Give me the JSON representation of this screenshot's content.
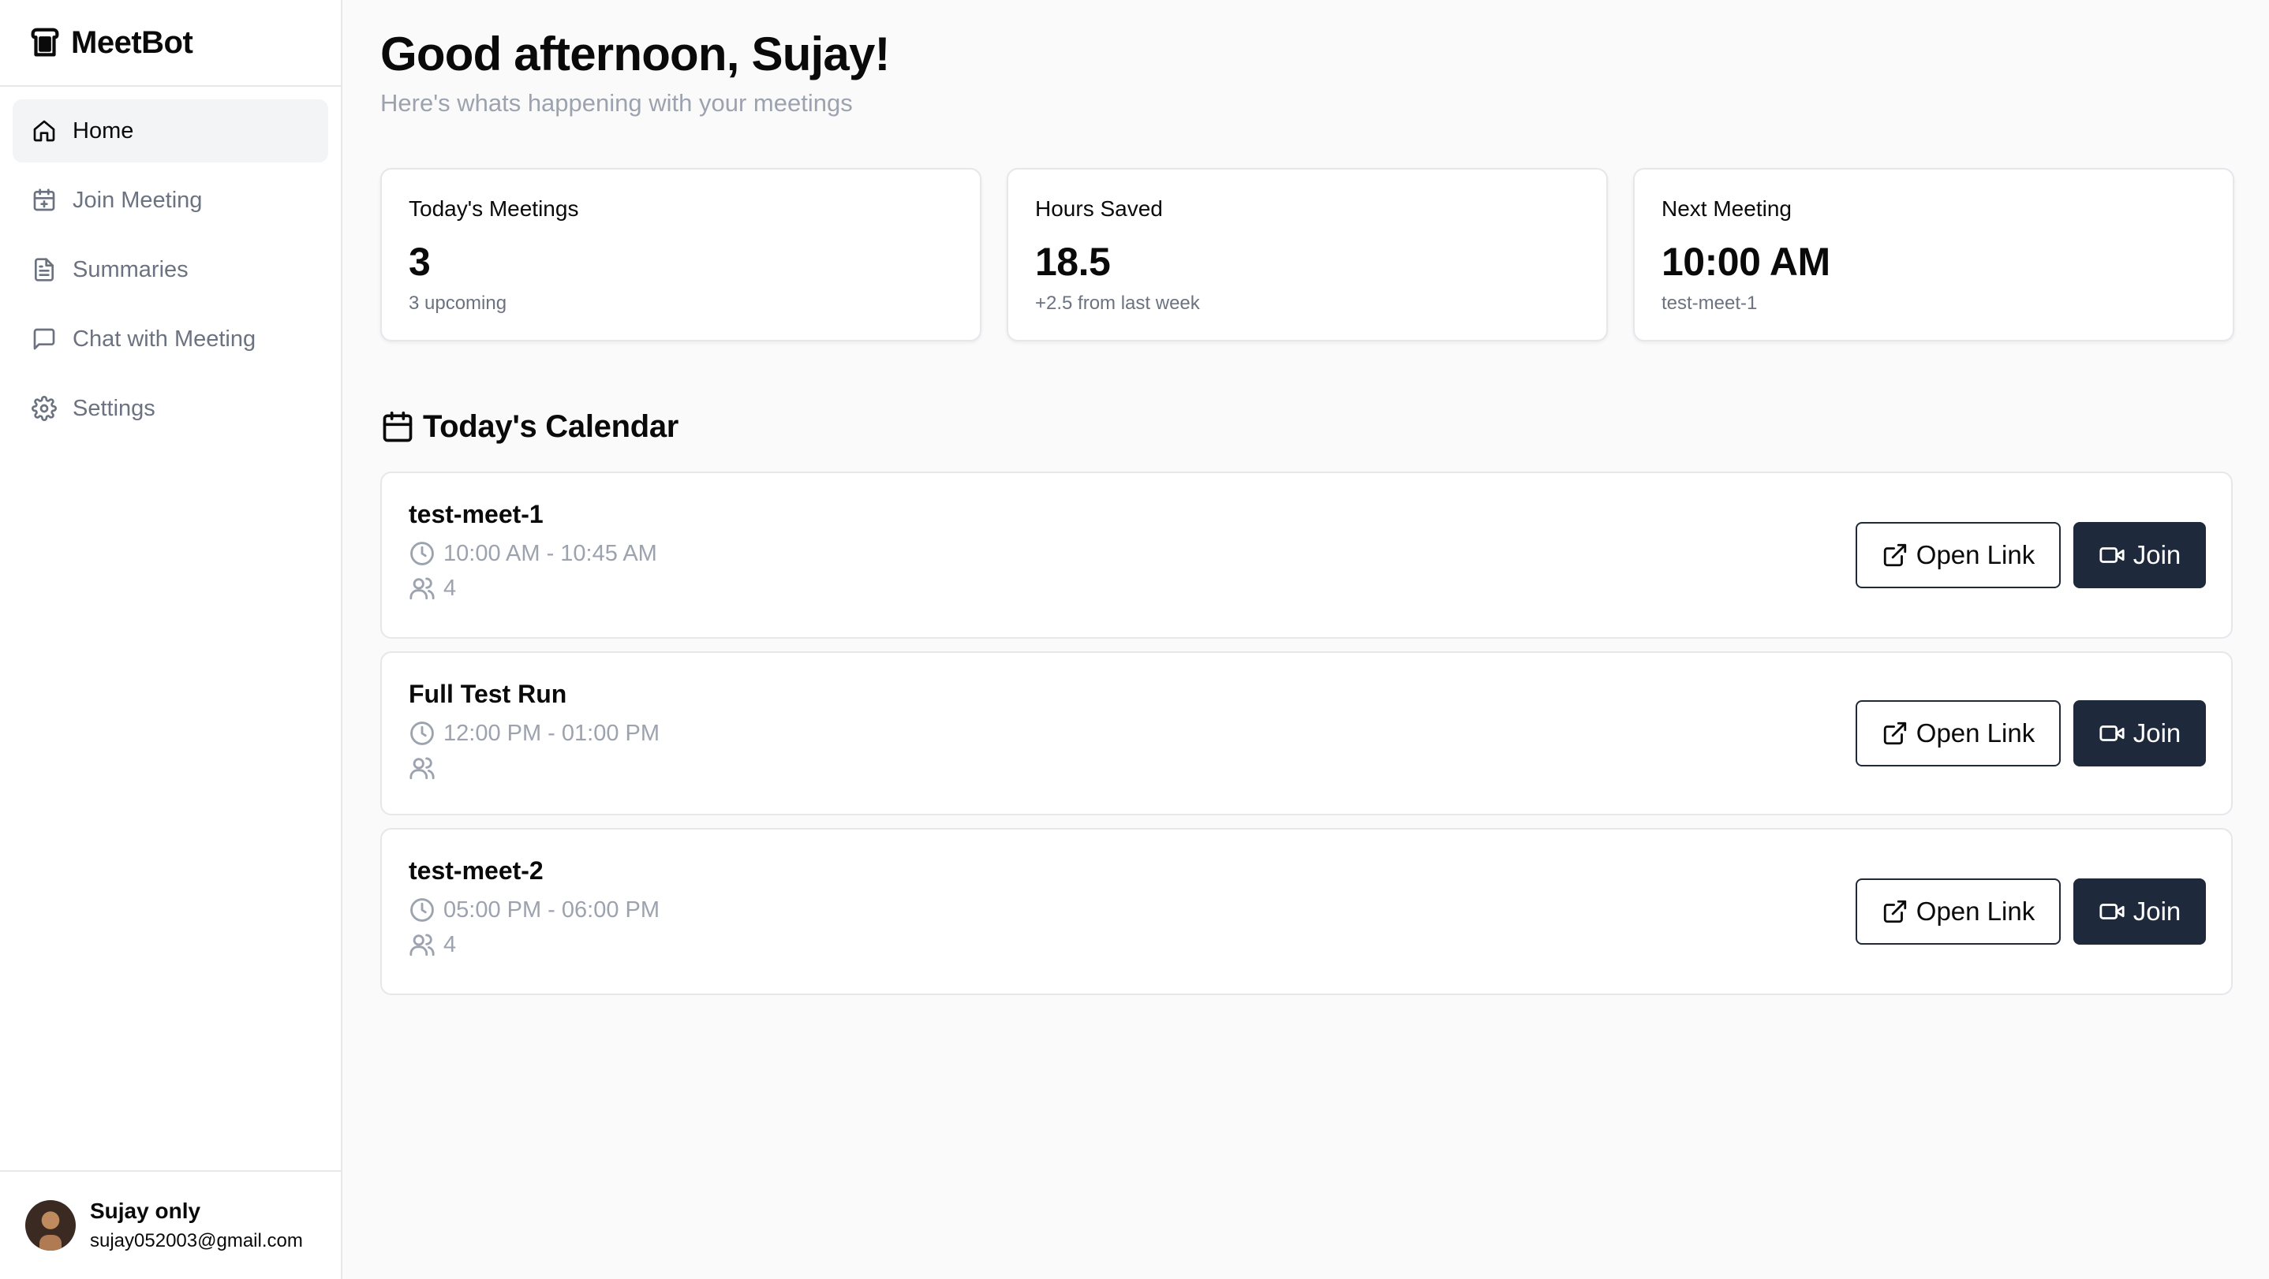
{
  "app": {
    "name": "MeetBot"
  },
  "sidebar": {
    "items": [
      {
        "label": "Home",
        "icon": "home-icon",
        "active": true
      },
      {
        "label": "Join Meeting",
        "icon": "calendar-plus-icon",
        "active": false
      },
      {
        "label": "Summaries",
        "icon": "file-text-icon",
        "active": false
      },
      {
        "label": "Chat with Meeting",
        "icon": "message-square-icon",
        "active": false
      },
      {
        "label": "Settings",
        "icon": "gear-icon",
        "active": false
      }
    ],
    "user": {
      "name": "Sujay only",
      "email": "sujay052003@gmail.com"
    }
  },
  "header": {
    "greeting": "Good afternoon, Sujay!",
    "subtitle": "Here's whats happening with your meetings"
  },
  "stats": [
    {
      "label": "Today's Meetings",
      "value": "3",
      "sub": "3 upcoming"
    },
    {
      "label": "Hours Saved",
      "value": "18.5",
      "sub": "+2.5 from last week"
    },
    {
      "label": "Next Meeting",
      "value": "10:00 AM",
      "sub": "test-meet-1"
    }
  ],
  "calendar": {
    "title": "Today's Calendar",
    "open_link_label": "Open Link",
    "join_label": "Join",
    "meetings": [
      {
        "title": "test-meet-1",
        "time": "10:00 AM - 10:45 AM",
        "participants": "4"
      },
      {
        "title": "Full Test Run",
        "time": "12:00 PM - 01:00 PM",
        "participants": ""
      },
      {
        "title": "test-meet-2",
        "time": "05:00 PM - 06:00 PM",
        "participants": "4"
      }
    ]
  },
  "colors": {
    "accent_dark": "#1e293b",
    "muted_text": "#9ca3af",
    "border": "#e5e7eb"
  }
}
